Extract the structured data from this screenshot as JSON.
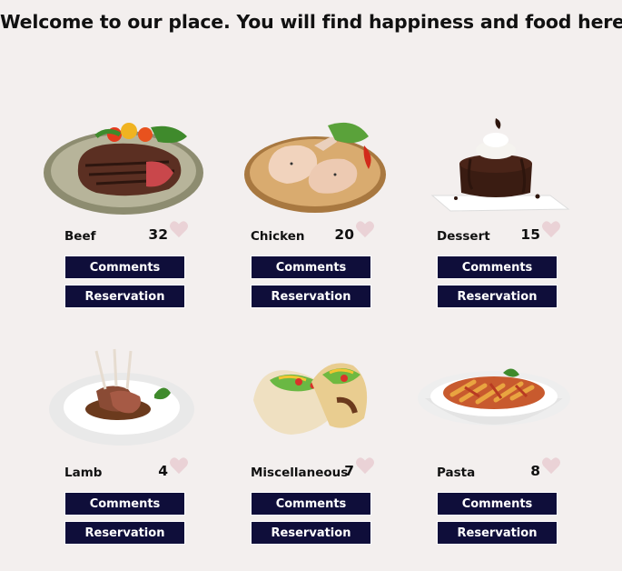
{
  "page": {
    "title": "Welcome to our place. You will find happiness and food here"
  },
  "colors": {
    "background": "#f3efee",
    "button_bg": "#0f0e3a",
    "button_text": "#ffffff",
    "heart": "#ead2d6"
  },
  "foods": [
    {
      "name": "Beef",
      "likes": "32",
      "image_icon": "steak-plate-image",
      "comments_label": "Comments",
      "reservation_label": "Reservation"
    },
    {
      "name": "Chicken",
      "likes": "20",
      "image_icon": "raw-chicken-image",
      "comments_label": "Comments",
      "reservation_label": "Reservation"
    },
    {
      "name": "Dessert",
      "likes": "15",
      "image_icon": "chocolate-cake-image",
      "comments_label": "Comments",
      "reservation_label": "Reservation"
    },
    {
      "name": "Lamb",
      "likes": "4",
      "image_icon": "lamb-chops-image",
      "comments_label": "Comments",
      "reservation_label": "Reservation"
    },
    {
      "name": "Miscellaneous",
      "likes": "7",
      "image_icon": "tacos-image",
      "comments_label": "Comments",
      "reservation_label": "Reservation"
    },
    {
      "name": "Pasta",
      "likes": "8",
      "image_icon": "pasta-bowl-image",
      "comments_label": "Comments",
      "reservation_label": "Reservation"
    }
  ]
}
